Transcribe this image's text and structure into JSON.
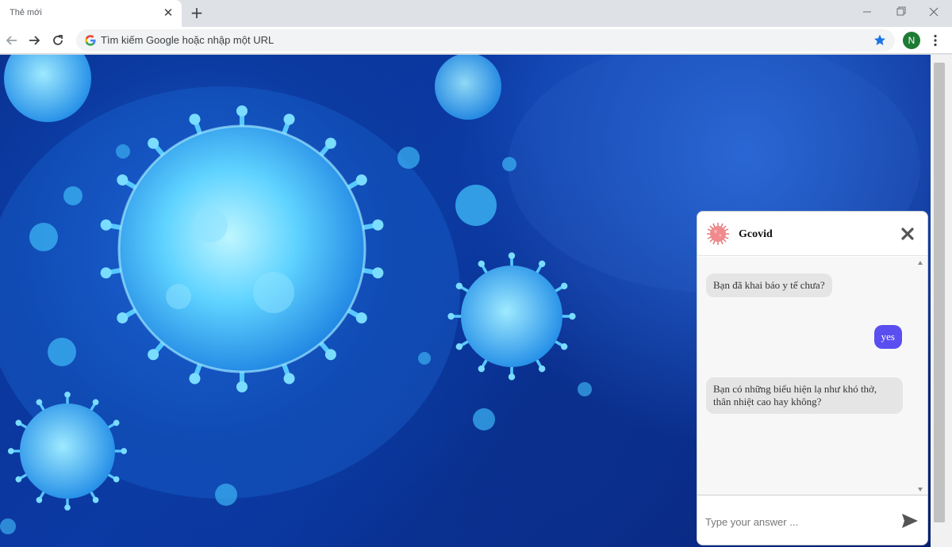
{
  "browser": {
    "tab_title": "Thẻ mới",
    "tab_close_glyph": "✕",
    "new_tab_glyph": "+",
    "omnibox_text": "Tìm kiếm Google hoặc nhập một URL",
    "avatar_letter": "N",
    "accent_color": "#1a73e8",
    "avatar_color": "#1e7b34"
  },
  "chat": {
    "title": "Gcovid",
    "messages": [
      {
        "from": "bot",
        "text": "Bạn đã khai báo y tế chưa?"
      },
      {
        "from": "user",
        "text": "yes"
      },
      {
        "from": "bot",
        "text": "Bạn có những biểu hiện lạ như khó thở, thân nhiệt cao hay không?"
      }
    ],
    "input_placeholder": "Type your answer ...",
    "user_bubble_color": "#5b4ef0",
    "bot_bubble_color": "#e5e5e5"
  }
}
